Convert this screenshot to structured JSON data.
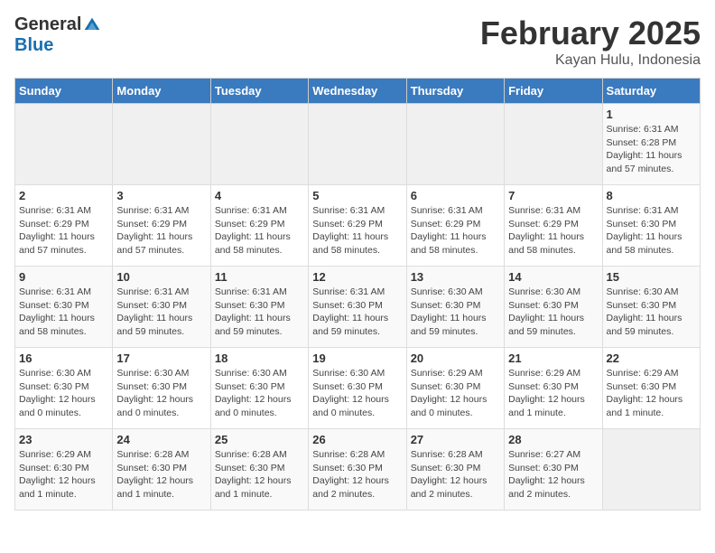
{
  "header": {
    "logo_general": "General",
    "logo_blue": "Blue",
    "month_title": "February 2025",
    "location": "Kayan Hulu, Indonesia"
  },
  "weekdays": [
    "Sunday",
    "Monday",
    "Tuesday",
    "Wednesday",
    "Thursday",
    "Friday",
    "Saturday"
  ],
  "weeks": [
    [
      {
        "day": "",
        "info": ""
      },
      {
        "day": "",
        "info": ""
      },
      {
        "day": "",
        "info": ""
      },
      {
        "day": "",
        "info": ""
      },
      {
        "day": "",
        "info": ""
      },
      {
        "day": "",
        "info": ""
      },
      {
        "day": "1",
        "info": "Sunrise: 6:31 AM\nSunset: 6:28 PM\nDaylight: 11 hours and 57 minutes."
      }
    ],
    [
      {
        "day": "2",
        "info": "Sunrise: 6:31 AM\nSunset: 6:29 PM\nDaylight: 11 hours and 57 minutes."
      },
      {
        "day": "3",
        "info": "Sunrise: 6:31 AM\nSunset: 6:29 PM\nDaylight: 11 hours and 57 minutes."
      },
      {
        "day": "4",
        "info": "Sunrise: 6:31 AM\nSunset: 6:29 PM\nDaylight: 11 hours and 58 minutes."
      },
      {
        "day": "5",
        "info": "Sunrise: 6:31 AM\nSunset: 6:29 PM\nDaylight: 11 hours and 58 minutes."
      },
      {
        "day": "6",
        "info": "Sunrise: 6:31 AM\nSunset: 6:29 PM\nDaylight: 11 hours and 58 minutes."
      },
      {
        "day": "7",
        "info": "Sunrise: 6:31 AM\nSunset: 6:29 PM\nDaylight: 11 hours and 58 minutes."
      },
      {
        "day": "8",
        "info": "Sunrise: 6:31 AM\nSunset: 6:30 PM\nDaylight: 11 hours and 58 minutes."
      }
    ],
    [
      {
        "day": "9",
        "info": "Sunrise: 6:31 AM\nSunset: 6:30 PM\nDaylight: 11 hours and 58 minutes."
      },
      {
        "day": "10",
        "info": "Sunrise: 6:31 AM\nSunset: 6:30 PM\nDaylight: 11 hours and 59 minutes."
      },
      {
        "day": "11",
        "info": "Sunrise: 6:31 AM\nSunset: 6:30 PM\nDaylight: 11 hours and 59 minutes."
      },
      {
        "day": "12",
        "info": "Sunrise: 6:31 AM\nSunset: 6:30 PM\nDaylight: 11 hours and 59 minutes."
      },
      {
        "day": "13",
        "info": "Sunrise: 6:30 AM\nSunset: 6:30 PM\nDaylight: 11 hours and 59 minutes."
      },
      {
        "day": "14",
        "info": "Sunrise: 6:30 AM\nSunset: 6:30 PM\nDaylight: 11 hours and 59 minutes."
      },
      {
        "day": "15",
        "info": "Sunrise: 6:30 AM\nSunset: 6:30 PM\nDaylight: 11 hours and 59 minutes."
      }
    ],
    [
      {
        "day": "16",
        "info": "Sunrise: 6:30 AM\nSunset: 6:30 PM\nDaylight: 12 hours and 0 minutes."
      },
      {
        "day": "17",
        "info": "Sunrise: 6:30 AM\nSunset: 6:30 PM\nDaylight: 12 hours and 0 minutes."
      },
      {
        "day": "18",
        "info": "Sunrise: 6:30 AM\nSunset: 6:30 PM\nDaylight: 12 hours and 0 minutes."
      },
      {
        "day": "19",
        "info": "Sunrise: 6:30 AM\nSunset: 6:30 PM\nDaylight: 12 hours and 0 minutes."
      },
      {
        "day": "20",
        "info": "Sunrise: 6:29 AM\nSunset: 6:30 PM\nDaylight: 12 hours and 0 minutes."
      },
      {
        "day": "21",
        "info": "Sunrise: 6:29 AM\nSunset: 6:30 PM\nDaylight: 12 hours and 1 minute."
      },
      {
        "day": "22",
        "info": "Sunrise: 6:29 AM\nSunset: 6:30 PM\nDaylight: 12 hours and 1 minute."
      }
    ],
    [
      {
        "day": "23",
        "info": "Sunrise: 6:29 AM\nSunset: 6:30 PM\nDaylight: 12 hours and 1 minute."
      },
      {
        "day": "24",
        "info": "Sunrise: 6:28 AM\nSunset: 6:30 PM\nDaylight: 12 hours and 1 minute."
      },
      {
        "day": "25",
        "info": "Sunrise: 6:28 AM\nSunset: 6:30 PM\nDaylight: 12 hours and 1 minute."
      },
      {
        "day": "26",
        "info": "Sunrise: 6:28 AM\nSunset: 6:30 PM\nDaylight: 12 hours and 2 minutes."
      },
      {
        "day": "27",
        "info": "Sunrise: 6:28 AM\nSunset: 6:30 PM\nDaylight: 12 hours and 2 minutes."
      },
      {
        "day": "28",
        "info": "Sunrise: 6:27 AM\nSunset: 6:30 PM\nDaylight: 12 hours and 2 minutes."
      },
      {
        "day": "",
        "info": ""
      }
    ]
  ]
}
